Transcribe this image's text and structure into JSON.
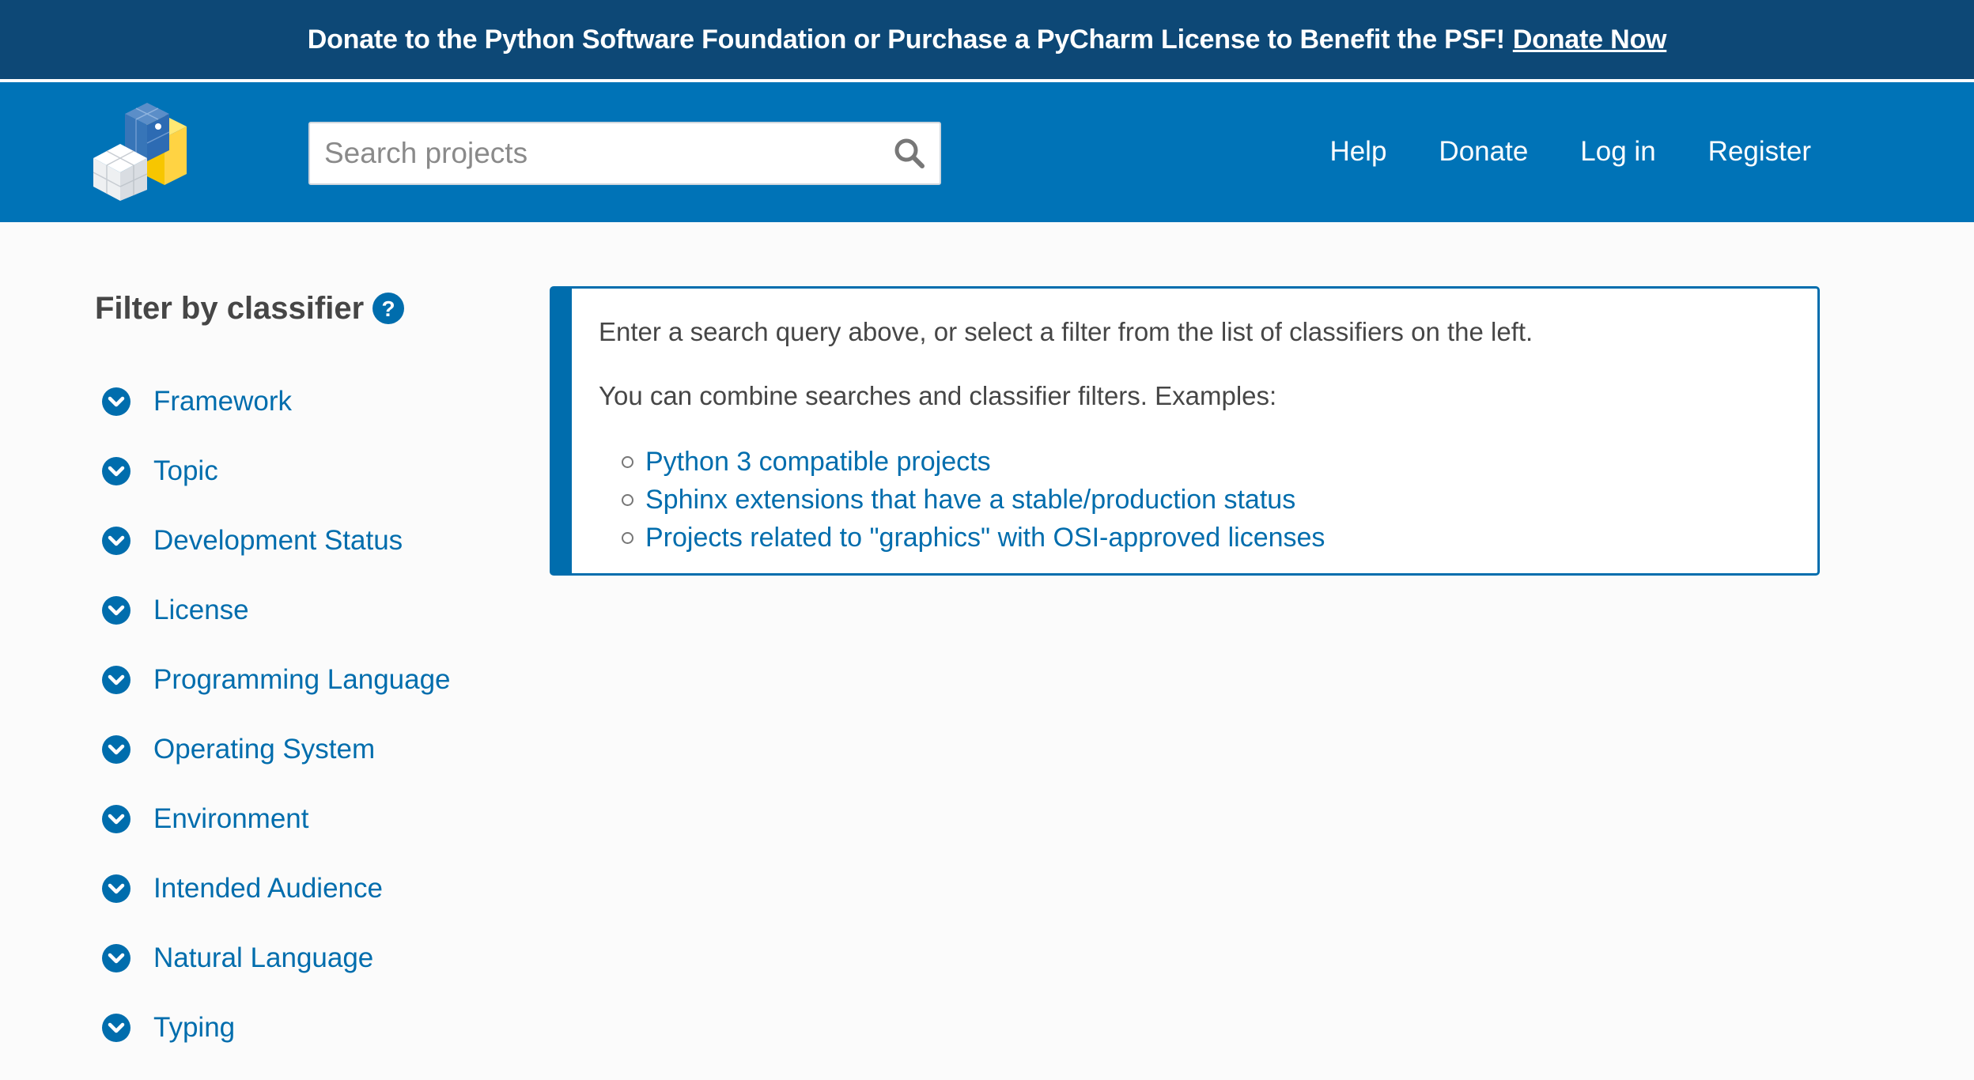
{
  "banner": {
    "message": "Donate to the Python Software Foundation or Purchase a PyCharm License to Benefit the PSF!",
    "link": "Donate Now"
  },
  "header": {
    "logo_icon": "pypi-logo-icon",
    "search": {
      "placeholder": "Search projects",
      "value": "",
      "icon": "search-icon"
    },
    "nav": [
      "Help",
      "Donate",
      "Log in",
      "Register"
    ]
  },
  "sidebar": {
    "title": "Filter by classifier",
    "help_icon": "question-circle-icon",
    "filters": [
      {
        "label": "Framework",
        "icon": "chevron-down-circle-icon"
      },
      {
        "label": "Topic",
        "icon": "chevron-down-circle-icon"
      },
      {
        "label": "Development Status",
        "icon": "chevron-down-circle-icon"
      },
      {
        "label": "License",
        "icon": "chevron-down-circle-icon"
      },
      {
        "label": "Programming Language",
        "icon": "chevron-down-circle-icon"
      },
      {
        "label": "Operating System",
        "icon": "chevron-down-circle-icon"
      },
      {
        "label": "Environment",
        "icon": "chevron-down-circle-icon"
      },
      {
        "label": "Intended Audience",
        "icon": "chevron-down-circle-icon"
      },
      {
        "label": "Natural Language",
        "icon": "chevron-down-circle-icon"
      },
      {
        "label": "Typing",
        "icon": "chevron-down-circle-icon"
      }
    ]
  },
  "panel": {
    "line1": "Enter a search query above, or select a filter from the list of classifiers on the left.",
    "line2": "You can combine searches and classifier filters. Examples:",
    "examples": [
      "Python 3 compatible projects",
      "Sphinx extensions that have a stable/production status",
      "Projects related to \"graphics\" with OSI-approved licenses"
    ]
  },
  "colors": {
    "banner_bg": "#0d4876",
    "header_bg": "#0073b7",
    "link": "#006dad",
    "page_bg": "#fbfbfb",
    "text": "#464646"
  }
}
